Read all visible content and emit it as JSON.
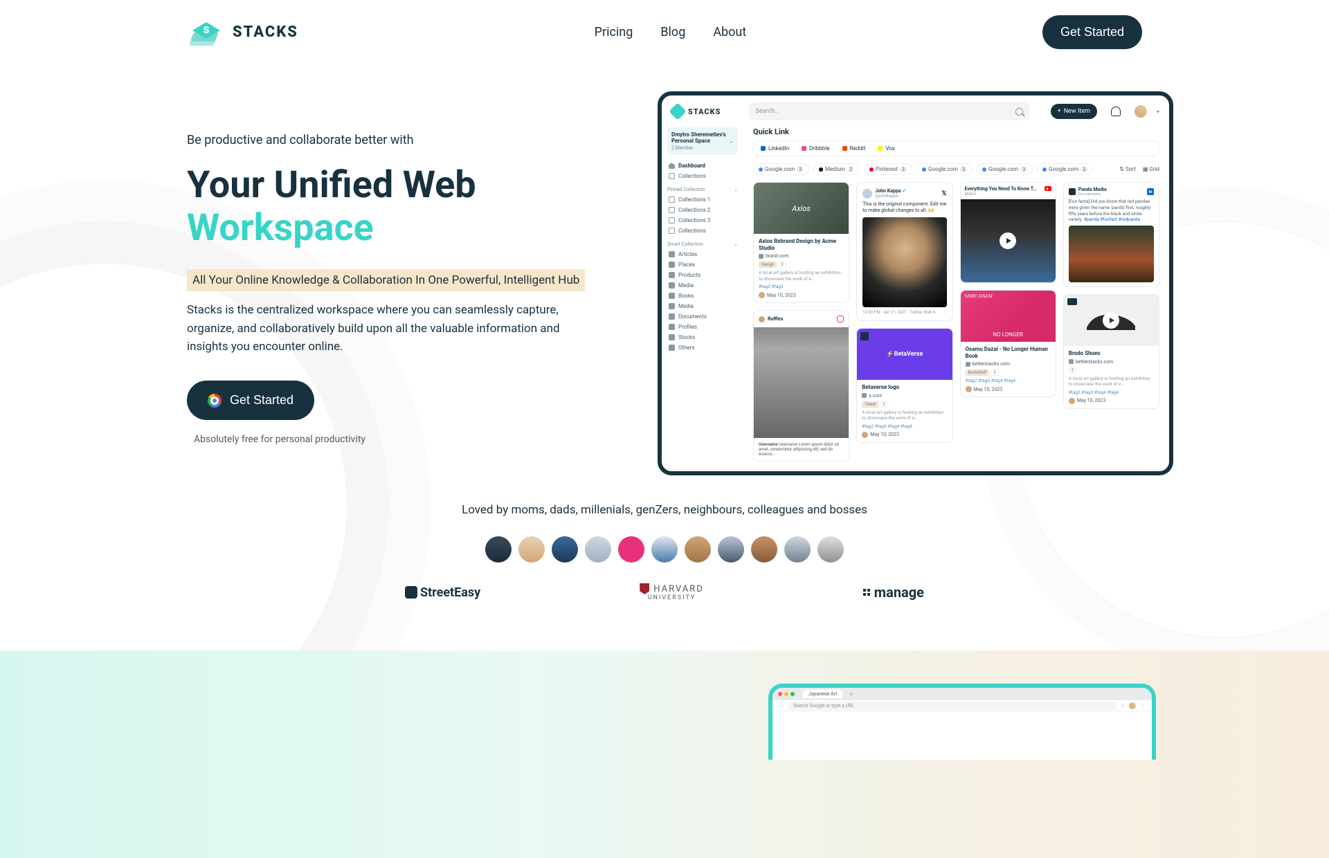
{
  "brand": {
    "name": "STACKS"
  },
  "nav": {
    "links": [
      "Pricing",
      "Blog",
      "About"
    ],
    "cta": "Get Started"
  },
  "hero": {
    "eyebrow": "Be productive and collaborate better with",
    "headline_line1": "Your Unified Web",
    "headline_line2": "Workspace",
    "highlight": "All Your Online Knowledge & Collaboration In One Powerful, Intelligent Hub",
    "description": "Stacks is the centralized workspace where you can seamlessly capture, organize, and collaboratively build upon all the valuable information and insights you encounter online.",
    "cta": "Get Started",
    "subtext": "Absolutely free for personal productivity"
  },
  "app": {
    "search_placeholder": "Search..",
    "new_item": "New Item",
    "space": {
      "name": "Dmytro Sheremetiev's Personal Space",
      "members": "2 Member"
    },
    "nav_primary": [
      {
        "label": "Dashboard",
        "active": true
      },
      {
        "label": "Collections"
      }
    ],
    "pinned_header": "Pinned Collection",
    "pinned": [
      "Collections 1",
      "Collections 2",
      "Collections 3",
      "Collections"
    ],
    "smart_header": "Smart Collection",
    "smart": [
      "Articles",
      "Places",
      "Products",
      "Media",
      "Books",
      "Media",
      "Documents",
      "Profiles",
      "Stocks",
      "Others"
    ],
    "quicklink_title": "Quick Link",
    "quicklinks": [
      {
        "label": "LinkedIn",
        "color": "#0a66c2"
      },
      {
        "label": "Dribbble",
        "color": "#ea4c89"
      },
      {
        "label": "Reddit",
        "color": "#ff4500"
      },
      {
        "label": "Vox",
        "color": "#fff200"
      }
    ],
    "filters": [
      {
        "label": "Google.com",
        "count": 3
      },
      {
        "label": "Medium",
        "count": 2
      },
      {
        "label": "Pinterest",
        "count": 3
      },
      {
        "label": "Google.com",
        "count": 3
      },
      {
        "label": "Google.com",
        "count": 3
      },
      {
        "label": "Google.com",
        "count": 3
      }
    ],
    "sort": "Sort",
    "view": "Grid",
    "cards": {
      "axios": {
        "img_text": "Axios",
        "title": "Axios Rebrand Design by Acme Studio",
        "site": "brand.com",
        "tags": [
          "Design",
          "3"
        ],
        "blurb": "A local art gallery is hosting an exhibition to showcase the work of e...",
        "tags2": "#tag2 #tag3",
        "date": "May 10, 2023"
      },
      "tweet": {
        "name": "John Kappa",
        "handle": "@johnkappa",
        "body": "This is the original component. Edit me to make global changes to all. 🙌",
        "timestamp": "12:30 PM · Apr 21, 2021 · Twitter Web A"
      },
      "cat": {
        "height_note": "tall cat image"
      },
      "video": {
        "title": "Everything You Need To Know T...",
        "sub": "Mubin"
      },
      "panda": {
        "name": "Panda Media",
        "sub": "2m members",
        "text": "[Fun facts] Did you know that red pandas were given the name 'panda' first, roughly fifty years before the black and white variety.",
        "tags": "#panda #funfact #redpanda"
      },
      "ruffles": {
        "name": "Ruffles"
      },
      "bwcaption": "Username Lorem ipsum dolor sit amet, consectetur adipiscing elit, sed do eiusmo...",
      "beta": {
        "logo": "BetaVerse",
        "title": "Betaverse logo",
        "site": "x.com",
        "tag": "Tweet",
        "blurb": "A local art gallery is hosting an exhibition to showcase the work of e...",
        "tags2": "#tag2 #tag3 #tag4 #tag4",
        "date": "May 10, 2023"
      },
      "dazai": {
        "img_text": "NO LONGER",
        "title": "Osamu Dazai - No Longer Human Book",
        "site": "betterstacks.com",
        "tag": "Bookshelf",
        "tags2": "#tag2 #tag3 #tag4 #tag4",
        "date": "May 10, 2023"
      },
      "shoe": {
        "title": "Brodo Shoes",
        "site": "betterstacks.com",
        "blurb": "A local art gallery is hosting an exhibition to showcase the work of e...",
        "tags2": "#tag2 #tag3 #tag4 #tag4",
        "date": "May 10, 2023"
      }
    }
  },
  "social": {
    "text": "Loved by moms, dads, millenials, genZers, neighbours, colleagues and bosses",
    "logos": {
      "streeteasy": "StreetEasy",
      "harvard_top": "HARVARD",
      "harvard_sub": "UNIVERSITY",
      "manage": "manage"
    }
  },
  "browser_peek": {
    "tab": "Japanese Art",
    "url": "Search Google or type a URL"
  }
}
